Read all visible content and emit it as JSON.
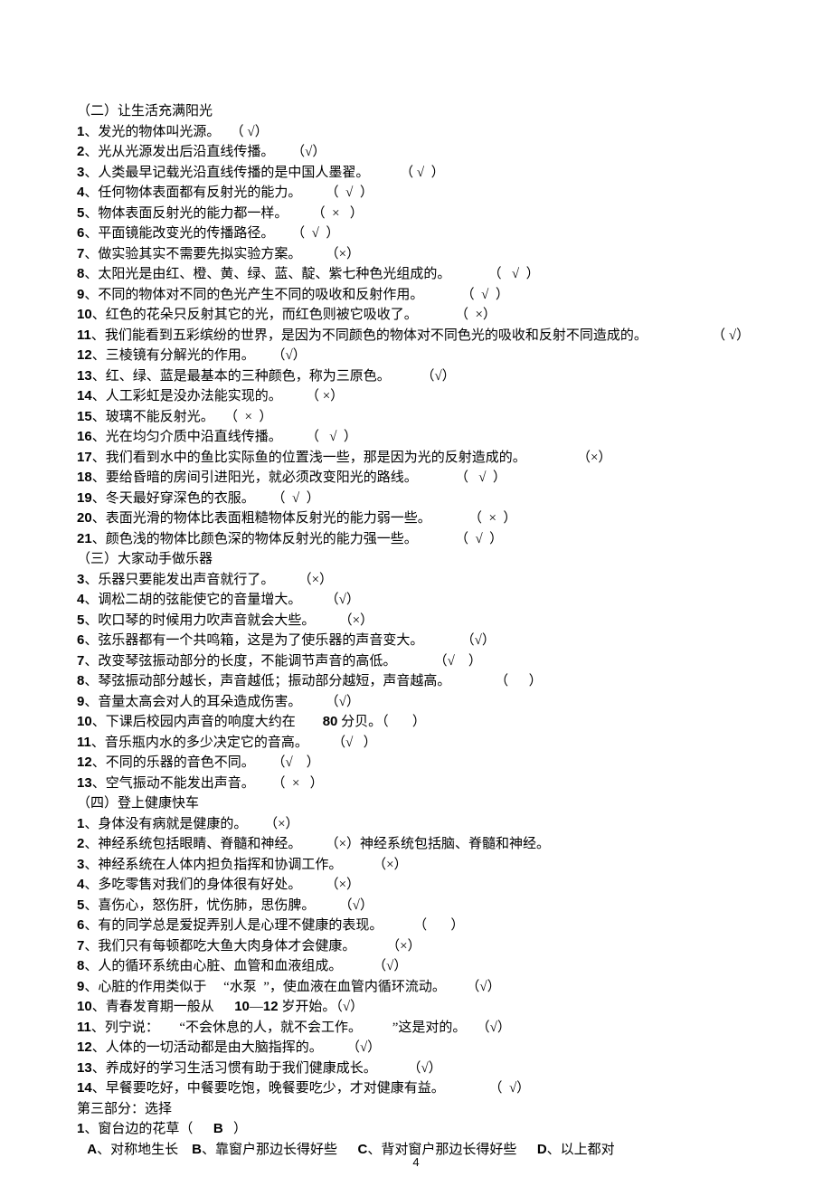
{
  "page_number": "4",
  "lines": [
    {
      "num": "",
      "text": "（二）让生活充满阳光"
    },
    {
      "num": "1",
      "text": "、发光的物体叫光源。   （ √）"
    },
    {
      "num": "2",
      "text": "、光从光源发出后沿直线传播。     （√）"
    },
    {
      "num": "3",
      "text": "、人类最早记载光沿直线传播的是中国人墨翟。         （ √  ）"
    },
    {
      "num": "4",
      "text": "、任何物体表面都有反射光的能力。       （  √  ）"
    },
    {
      "num": "5",
      "text": "、物体表面反射光的能力都一样。       （  ×   ）"
    },
    {
      "num": "6",
      "text": "、平面镜能改变光的传播路径。     （  √  ）"
    },
    {
      "num": "7",
      "text": "、做实验其实不需要先拟实验方案。       （×）"
    },
    {
      "num": "8",
      "text": "、太阳光是由红、橙、黄、绿、蓝、靛、紫七种色光组成的。           （   √  ）"
    },
    {
      "num": "9",
      "text": "、不同的物体对不同的色光产生不同的吸收和反射作用。           （  √  ）"
    },
    {
      "num": "10",
      "text": "、红色的花朵只反射其它的光，而红色则被它吸收了。           （  ×）"
    },
    {
      "num": "11",
      "text": "、我们能看到五彩缤纷的世界，是因为不同颜色的物体对不同色光的吸收和反射不同造成的。                   （ √）"
    },
    {
      "num": "12",
      "text": "、三棱镜有分解光的作用。     （√）"
    },
    {
      "num": "13",
      "text": "、红、绿、蓝是最基本的三种颜色，称为三原色。         （√）"
    },
    {
      "num": "14",
      "text": "、人工彩虹是没办法能实现的。       （ ×）"
    },
    {
      "num": "15",
      "text": "、玻璃不能反射光。   （  ×  ）"
    },
    {
      "num": "16",
      "text": "、光在均匀介质中沿直线传播。       （   √  ）"
    },
    {
      "num": "17",
      "text": "、我们看到水中的鱼比实际鱼的位置浅一些，那是因为光的反射造成的。               （×）"
    },
    {
      "num": "18",
      "text": "、要给昏暗的房间引进阳光，就必须改变阳光的路线。           （   √  ）"
    },
    {
      "num": "19",
      "text": "、冬天最好穿深色的衣服。     （  √  ）"
    },
    {
      "num": "20",
      "text": "、表面光滑的物体比表面粗糙物体反射光的能力弱一些。           （  ×  ）"
    },
    {
      "num": "21",
      "text": "、颜色浅的物体比颜色深的物体反射光的能力强一些。           （  √  ）"
    },
    {
      "num": "",
      "text": "（三）大家动手做乐器"
    },
    {
      "num": "3",
      "text": "、乐器只要能发出声音就行了。       （×）"
    },
    {
      "num": "4",
      "text": "、调松二胡的弦能使它的音量增大。       （√）"
    },
    {
      "num": "5",
      "text": "、吹口琴的时候用力吹声音就会大些。       （×）"
    },
    {
      "num": "6",
      "text": "、弦乐器都有一个共鸣箱，这是为了使乐器的声音变大。           （√）"
    },
    {
      "num": "7",
      "text": "、改变琴弦振动部分的长度，不能调节声音的高低。           （√    ）"
    },
    {
      "num": "8",
      "text": "、琴弦振动部分越长，声音越低；振动部分越短，声音越高。             （      ）"
    },
    {
      "num": "9",
      "text": "、音量太高会对人的耳朵造成伤害。       （√）"
    },
    {
      "num": "10",
      "text": "、下课后校园内声音的响度大约在        ",
      "num2": "80",
      "text2": " 分贝。（       ）"
    },
    {
      "num": "11",
      "text": "、音乐瓶内水的多少决定它的音高。       （√   ）"
    },
    {
      "num": "12",
      "text": "、不同的乐器的音色不同。     （√    ）"
    },
    {
      "num": "13",
      "text": "、空气振动不能发出声音。     （  ×   ）"
    },
    {
      "num": "",
      "text": "（四）登上健康快车"
    },
    {
      "num": "1",
      "text": "、身体没有病就是健康的。     （×）"
    },
    {
      "num": "2",
      "text": "、神经系统包括眼睛、脊髓和神经。       （×）神经系统包括脑、脊髓和神经。"
    },
    {
      "num": "3",
      "text": "、神经系统在人体内担负指挥和协调工作。         （×）"
    },
    {
      "num": "4",
      "text": "、多吃零售对我们的身体很有好处。       （×）"
    },
    {
      "num": "5",
      "text": "、喜伤心，怒伤肝，忧伤肺，思伤脾。       （√）"
    },
    {
      "num": "6",
      "text": "、有的同学总是爱捉弄别人是心理不健康的表现。         （       ）"
    },
    {
      "num": "7",
      "text": "、我们只有每顿都吃大鱼大肉身体才会健康。         （×）"
    },
    {
      "num": "8",
      "text": "、人的循环系统由心脏、血管和血液组成。         （√）"
    },
    {
      "num": "9",
      "text": "、心脏的作用类似于     “水泵  ”，使血液在血管内循环流动。      （√）"
    },
    {
      "num": "10",
      "text": "、青春发育期一般从      ",
      "num2": "10",
      "text2": "—",
      "num3": "12",
      "text3": " 岁开始。（√）"
    },
    {
      "num": "11",
      "text": "、列宁说：      “不会休息的人，就不会工作。         ”这是对的。   （√）"
    },
    {
      "num": "12",
      "text": "、人体的一切活动都是由大脑指挥的。       （√）"
    },
    {
      "num": "13",
      "text": "、养成好的学习生活习惯有助于我们健康成长。         （√）"
    },
    {
      "num": "14",
      "text": "、早餐要吃好，中餐要吃饱，晚餐要吃少，才对健康有益。             （  √）"
    },
    {
      "num": "",
      "text": "第三部分：选择"
    },
    {
      "num": "1",
      "text": "、窗台边的花草（      ",
      "num2": "B",
      "text2": "   ）"
    },
    {
      "indent": true,
      "num": "A",
      "text": "、对称地生长    ",
      "num2": "B",
      "text2": "、靠窗户那边长得好些      ",
      "num3": "C",
      "text3": "、背对窗户那边长得好些      ",
      "num4": "D",
      "text4": "、以上都对"
    }
  ]
}
